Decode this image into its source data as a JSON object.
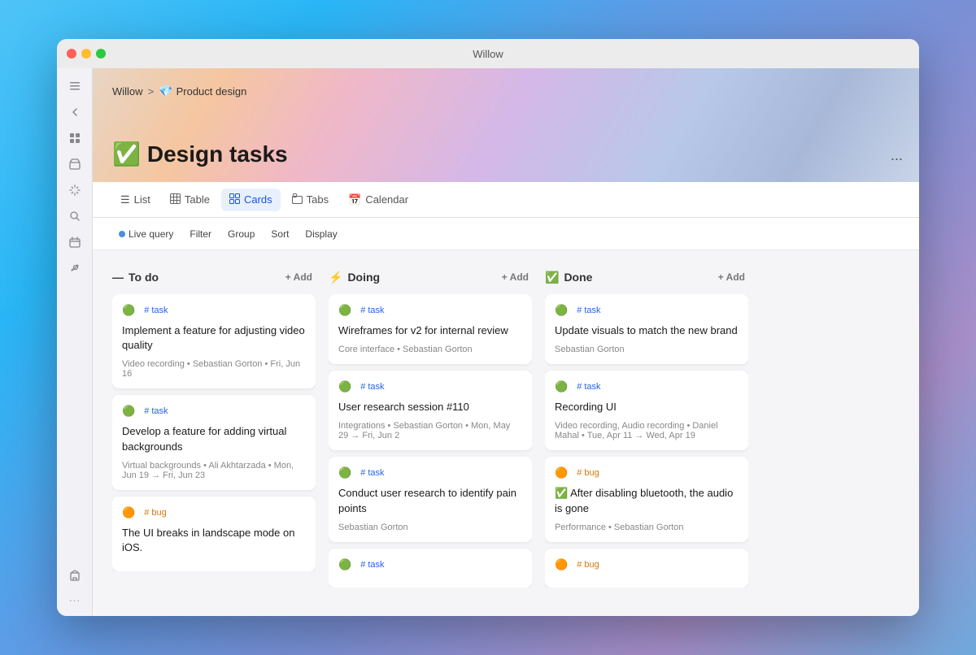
{
  "app": {
    "title": "Willow"
  },
  "window_controls": {
    "red": "close",
    "yellow": "minimize",
    "green": "maximize"
  },
  "sidebar": {
    "icons": [
      "sidebar-toggle",
      "back-arrow",
      "grid-icon",
      "inbox-icon",
      "sparkle-icon",
      "search-icon",
      "calendar-icon",
      "pin-icon",
      "building-icon"
    ]
  },
  "breadcrumb": {
    "parent": "Willow",
    "separator": ">",
    "icon": "💎",
    "current": "Product design"
  },
  "page": {
    "title_icon": "✅",
    "title": "Design tasks",
    "more": "..."
  },
  "tabs": [
    {
      "id": "list",
      "icon": "☰",
      "label": "List",
      "active": false
    },
    {
      "id": "table",
      "icon": "⊞",
      "label": "Table",
      "active": false
    },
    {
      "id": "cards",
      "icon": "⊡",
      "label": "Cards",
      "active": true
    },
    {
      "id": "tabs",
      "icon": "⊟",
      "label": "Tabs",
      "active": false
    },
    {
      "id": "calendar",
      "icon": "📅",
      "label": "Calendar",
      "active": false
    }
  ],
  "filter_bar": {
    "live_query": "Live query",
    "filter": "Filter",
    "group": "Group",
    "sort": "Sort",
    "display": "Display"
  },
  "columns": [
    {
      "id": "todo",
      "icon": "—",
      "title": "To do",
      "add_label": "+ Add",
      "cards": [
        {
          "type": "task",
          "type_icon": "🟢",
          "type_label": "# task",
          "title": "Implement a feature for adjusting video quality",
          "meta": "Video recording  •  Sebastian Gorton  •  Fri, Jun 16"
        },
        {
          "type": "task",
          "type_icon": "🟢",
          "type_label": "# task",
          "title": "Develop a feature for adding virtual backgrounds",
          "meta": "Virtual backgrounds  •  Ali Akhtarzada  •  Mon, Jun 19 → Fri, Jun 23"
        },
        {
          "type": "bug",
          "type_icon": "🟠",
          "type_label": "# bug",
          "title": "The UI breaks in landscape mode on iOS.",
          "meta": ""
        }
      ]
    },
    {
      "id": "doing",
      "icon": "⚡",
      "title": "Doing",
      "add_label": "+ Add",
      "cards": [
        {
          "type": "task",
          "type_icon": "🟢",
          "type_label": "# task",
          "title": "Wireframes for v2 for internal review",
          "meta": "Core interface  •  Sebastian Gorton"
        },
        {
          "type": "task",
          "type_icon": "🟢",
          "type_label": "# task",
          "title": "User research session #110",
          "meta": "Integrations  •  Sebastian Gorton  •  Mon, May 29 → Fri, Jun 2"
        },
        {
          "type": "task",
          "type_icon": "🟢",
          "type_label": "# task",
          "title": "Conduct user research to identify pain points",
          "meta": "Sebastian Gorton"
        },
        {
          "type": "task",
          "type_icon": "🟢",
          "type_label": "# task",
          "title": "",
          "meta": ""
        }
      ]
    },
    {
      "id": "done",
      "icon": "✅",
      "title": "Done",
      "add_label": "+ Add",
      "cards": [
        {
          "type": "task",
          "type_icon": "🟢",
          "type_label": "# task",
          "title": "Update visuals to match the new brand",
          "meta": "Sebastian Gorton"
        },
        {
          "type": "task",
          "type_icon": "🟢",
          "type_label": "# task",
          "title": "Recording UI",
          "meta": "Video recording, Audio recording  •  Daniel Mahal  •  Tue, Apr 11 → Wed, Apr 19"
        },
        {
          "type": "bug",
          "type_icon": "🟠",
          "type_label": "# bug",
          "title": "After disabling bluetooth, the audio is gone",
          "meta": "Performance  •  Sebastian Gorton",
          "checked": true
        },
        {
          "type": "bug",
          "type_icon": "🟠",
          "type_label": "# bug",
          "title": "",
          "meta": ""
        }
      ]
    }
  ]
}
